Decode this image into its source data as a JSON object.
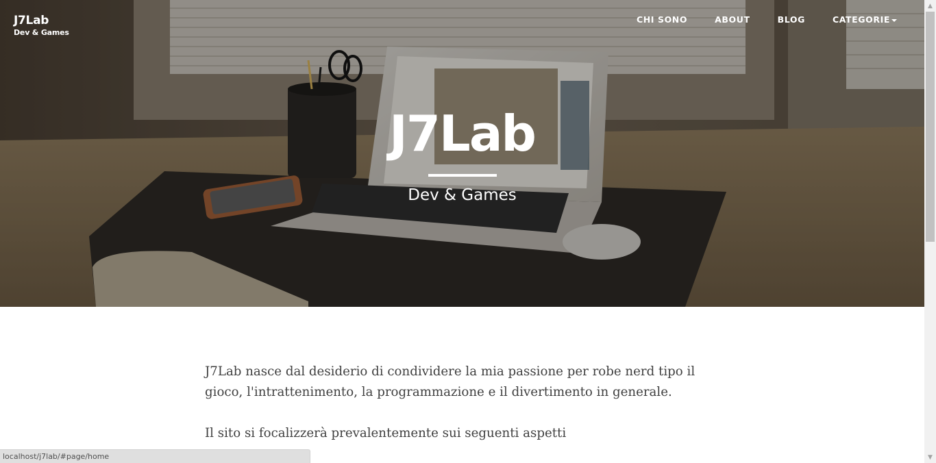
{
  "brand": {
    "title": "J7Lab",
    "subtitle": "Dev & Games"
  },
  "nav": {
    "items": [
      {
        "label": "CHI SONO"
      },
      {
        "label": "ABOUT"
      },
      {
        "label": "BLOG"
      },
      {
        "label": "CATEGORIE",
        "has_dropdown": true
      }
    ]
  },
  "hero": {
    "title": "J7Lab",
    "subtitle": "Dev & Games"
  },
  "content": {
    "paragraphs": [
      "J7Lab nasce dal desiderio di condividere la mia passione per robe nerd tipo il gioco, l'intrattenimento, la programmazione e il divertimento in generale.",
      "Il sito si focalizzerà prevalentemente sui seguenti aspetti"
    ]
  },
  "status_bar": {
    "url": "localhost/j7lab/#page/home"
  },
  "colors": {
    "hero_text": "#ffffff",
    "body_text": "#404040",
    "statusbar_bg": "#dfdfdf",
    "scrollbar_thumb": "#c1c1c1"
  }
}
